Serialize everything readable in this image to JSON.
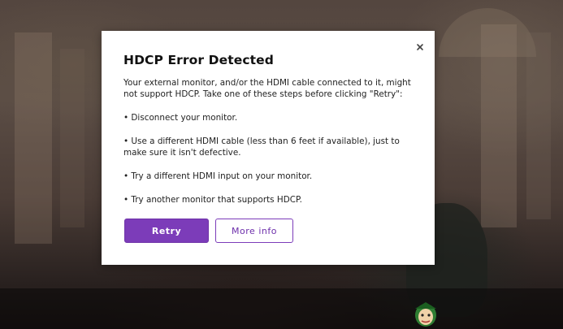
{
  "dialog": {
    "title": "HDCP Error Detected",
    "intro": "Your external monitor, and/or the HDMI cable connected to it, might not support HDCP. Take one of these steps before clicking \"Retry\":",
    "steps": [
      "• Disconnect your monitor.",
      "• Use a different HDMI cable (less than 6 feet if available), just to make sure it isn't defective.",
      "• Try a different HDMI input on your monitor.",
      "• Try another monitor that supports HDCP."
    ],
    "retry_label": "Retry",
    "more_info_label": "More info",
    "close_icon": "close-icon"
  },
  "colors": {
    "accent": "#7c3cb9",
    "dialog_bg": "#ffffff",
    "text": "#1f1f1f"
  }
}
